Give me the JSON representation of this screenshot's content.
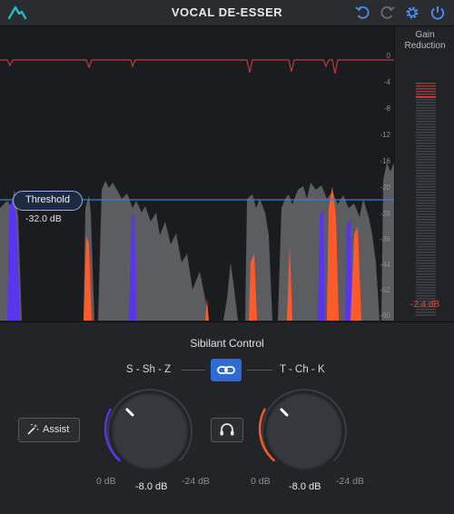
{
  "app": {
    "title": "VOCAL DE-ESSER"
  },
  "icons": {
    "logo": "brand-logo-icon",
    "undo": "undo-icon",
    "redo": "redo-icon",
    "settings": "gear-icon",
    "power": "power-icon",
    "link": "link-icon",
    "assist": "magic-wand-icon",
    "listen": "headphones-icon"
  },
  "colors": {
    "accent": "#2f6bd0",
    "sibilance_s": "#5a35f0",
    "sibilance_t": "#ff5a2a",
    "reduction": "#e0463e",
    "threshold": "#3d7de0"
  },
  "analyzer": {
    "threshold_label": "Threshold",
    "threshold_value": "-32.0 dB",
    "scale": [
      "0",
      "-4",
      "-8",
      "-12",
      "-16",
      "-20",
      "-28",
      "-36",
      "-44",
      "-52",
      "-60"
    ]
  },
  "meter": {
    "title_line1": "Gain",
    "title_line2": "Reduction",
    "value": "-2.4 dB"
  },
  "controls": {
    "section_title": "Sibilant Control",
    "left_group": "S - Sh - Z",
    "right_group": "T - Ch - K",
    "assist_label": "Assist",
    "left_knob": {
      "min": "0 dB",
      "max": "-24 dB",
      "value": "-8.0 dB"
    },
    "right_knob": {
      "min": "0 dB",
      "max": "-24 dB",
      "value": "-8.0 dB"
    }
  }
}
